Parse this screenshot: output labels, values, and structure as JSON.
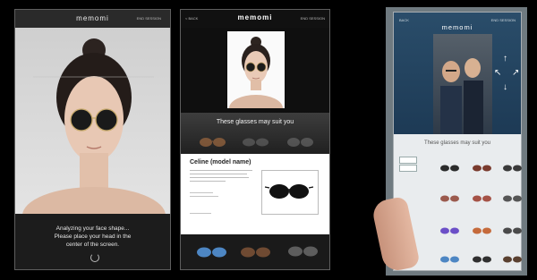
{
  "panel1": {
    "logo": "memomi",
    "header_link": "END SESSION",
    "message_line1": "Analyzing your face shape...",
    "message_line2": "Please place your head in the",
    "message_line3": "center of the screen."
  },
  "panel2": {
    "back": "< BACK",
    "logo": "memomi",
    "header_link": "END SESSION",
    "suit_heading": "These glasses may suit you",
    "product_name": "Celine (model name)"
  },
  "panel3": {
    "logo": "memomi",
    "back": "BACK",
    "header_link": "END SESSION",
    "suit_heading": "These glasses may suit you",
    "arrows": [
      "↑",
      "↓",
      "↖",
      "↗"
    ]
  },
  "colors": {
    "dark_bg": "#1c1c1c",
    "lens": "#2b2b2b",
    "accent_purple": "#6b4fc7",
    "accent_blue": "#4d86c3",
    "brown": "#8b5e3c"
  }
}
